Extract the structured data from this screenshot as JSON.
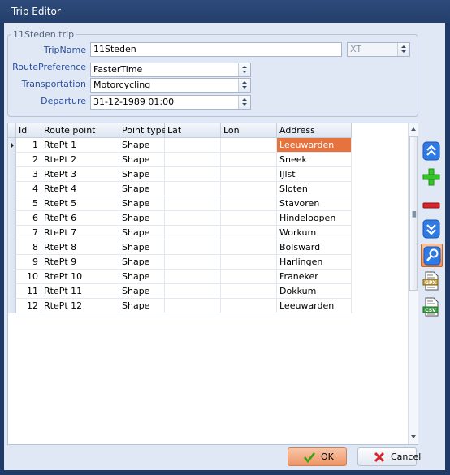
{
  "window": {
    "title": "Trip Editor"
  },
  "group": {
    "title": "11Steden.trip"
  },
  "form": {
    "trip_name_label": "TripName",
    "trip_name_value": "11Steden",
    "trip_type_value": "XT",
    "route_pref_label": "RoutePreference",
    "route_pref_value": "FasterTime",
    "transport_label": "Transportation",
    "transport_value": "Motorcycling",
    "departure_label": "Departure",
    "departure_value": "31-12-1989 01:00"
  },
  "grid": {
    "columns": [
      "Id",
      "Route point",
      "Point type",
      "Lat",
      "Lon",
      "Address"
    ],
    "rows": [
      {
        "id": "1",
        "route_point": "RtePt 1",
        "point_type": "Shape",
        "lat": "",
        "lon": "",
        "address": "Leeuwarden"
      },
      {
        "id": "2",
        "route_point": "RtePt 2",
        "point_type": "Shape",
        "lat": "",
        "lon": "",
        "address": "Sneek"
      },
      {
        "id": "3",
        "route_point": "RtePt 3",
        "point_type": "Shape",
        "lat": "",
        "lon": "",
        "address": "IJlst"
      },
      {
        "id": "4",
        "route_point": "RtePt 4",
        "point_type": "Shape",
        "lat": "",
        "lon": "",
        "address": "Sloten"
      },
      {
        "id": "5",
        "route_point": "RtePt 5",
        "point_type": "Shape",
        "lat": "",
        "lon": "",
        "address": "Stavoren"
      },
      {
        "id": "6",
        "route_point": "RtePt 6",
        "point_type": "Shape",
        "lat": "",
        "lon": "",
        "address": "Hindeloopen"
      },
      {
        "id": "7",
        "route_point": "RtePt 7",
        "point_type": "Shape",
        "lat": "",
        "lon": "",
        "address": "Workum"
      },
      {
        "id": "8",
        "route_point": "RtePt 8",
        "point_type": "Shape",
        "lat": "",
        "lon": "",
        "address": "Bolsward"
      },
      {
        "id": "9",
        "route_point": "RtePt 9",
        "point_type": "Shape",
        "lat": "",
        "lon": "",
        "address": "Harlingen"
      },
      {
        "id": "10",
        "route_point": "RtePt 10",
        "point_type": "Shape",
        "lat": "",
        "lon": "",
        "address": "Franeker"
      },
      {
        "id": "11",
        "route_point": "RtePt 11",
        "point_type": "Shape",
        "lat": "",
        "lon": "",
        "address": "Dokkum"
      },
      {
        "id": "12",
        "route_point": "RtePt 12",
        "point_type": "Shape",
        "lat": "",
        "lon": "",
        "address": "Leeuwarden"
      }
    ],
    "selected_row": 0
  },
  "toolbar": {
    "icons": [
      "move-up-icon",
      "add-icon",
      "remove-icon",
      "move-down-icon",
      "search-address-icon",
      "gpx-file-icon",
      "csv-file-icon"
    ]
  },
  "footer": {
    "ok_label": "OK",
    "cancel_label": "Cancel"
  },
  "colors": {
    "selection": "#e8723d",
    "titlebar": "#2d4a7a",
    "label": "#2a4fa0",
    "ok_button": "#ee9465"
  }
}
